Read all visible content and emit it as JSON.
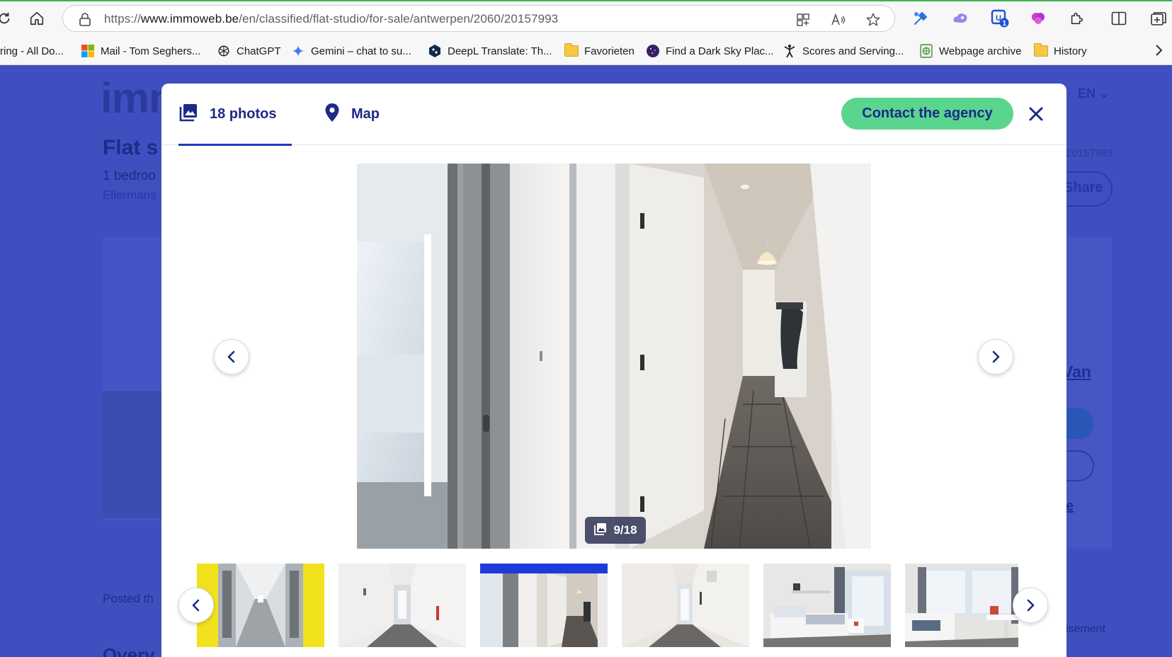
{
  "browser": {
    "url_prefix": "https://",
    "url_host": "www.immoweb.be",
    "url_path": "/en/classified/flat-studio/for-sale/antwerpen/2060/20157993",
    "extension_badge": "1",
    "bookmarks": [
      {
        "label": "ring - All Do...",
        "icon": "none"
      },
      {
        "label": "Mail - Tom Seghers...",
        "icon": "microsoft-icon"
      },
      {
        "label": "ChatGPT",
        "icon": "chatgpt-icon"
      },
      {
        "label": "Gemini – chat to su...",
        "icon": "gemini-icon"
      },
      {
        "label": "DeepL Translate: Th...",
        "icon": "deepl-icon"
      },
      {
        "label": "Favorieten",
        "icon": "folder-icon"
      },
      {
        "label": "Find a Dark Sky Plac...",
        "icon": "darksky-icon"
      },
      {
        "label": "Scores and Serving...",
        "icon": "person-icon"
      },
      {
        "label": "Webpage archive",
        "icon": "archive-icon"
      },
      {
        "label": "History",
        "icon": "folder-icon"
      }
    ]
  },
  "page": {
    "logo": "imm",
    "lang": "EN",
    "title": "Flat s",
    "sub1": "1 bedroo",
    "sub2": "Ellermans",
    "ref": "20157993",
    "share": "Share",
    "van": "Van",
    "e_link": "e",
    "posted": "Posted th",
    "isement": "isement",
    "overview": "Overv"
  },
  "modal": {
    "tabs": [
      {
        "label": "18 photos",
        "icon": "photos-icon",
        "active": true
      },
      {
        "label": "Map",
        "icon": "map-pin-icon",
        "active": false
      }
    ],
    "contact_label": "Contact the agency",
    "counter": "9/18",
    "photo_index": 9,
    "photo_total": 18
  },
  "colors": {
    "brand_blue": "#1d2a87",
    "accent_blue": "#1d3bbf",
    "contact_green": "#5ad58e",
    "page_overlay": "#3f4fc0"
  }
}
